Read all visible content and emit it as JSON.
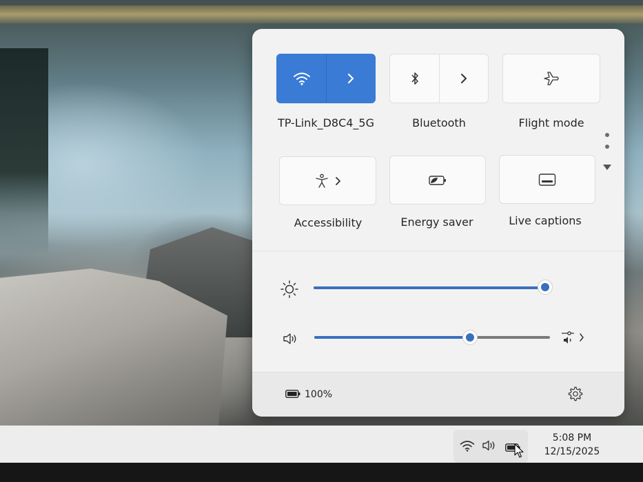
{
  "tiles": [
    {
      "label": "TP-Link_D8C4_5G",
      "icon": "wifi-icon",
      "expand": "chevron-right-icon",
      "active": true
    },
    {
      "label": "Bluetooth",
      "icon": "bluetooth-icon",
      "expand": "chevron-right-icon",
      "active": false
    },
    {
      "label": "Flight mode",
      "icon": "airplane-icon",
      "active": false
    },
    {
      "label": "Accessibility",
      "icon": "accessibility-icon",
      "expand": "chevron-right-icon",
      "active": false
    },
    {
      "label": "Energy saver",
      "icon": "energy-saver-icon",
      "active": false
    },
    {
      "label": "Live captions",
      "icon": "live-captions-icon",
      "active": false
    }
  ],
  "brightness": {
    "icon": "sun-icon",
    "level": 1.0
  },
  "volume": {
    "icon": "speaker-icon",
    "level": 0.66,
    "output_icon": "audio-output-icon"
  },
  "battery": {
    "icon": "battery-icon",
    "percent_text": "100%"
  },
  "settings_icon": "gear-icon",
  "taskbar": {
    "tray_icons": [
      "wifi-icon",
      "speaker-icon",
      "battery-icon"
    ],
    "time": "5:08 PM",
    "date": "12/15/2025"
  },
  "colors": {
    "accent": "#3a7bd5",
    "panel": "#f2f2f2"
  }
}
